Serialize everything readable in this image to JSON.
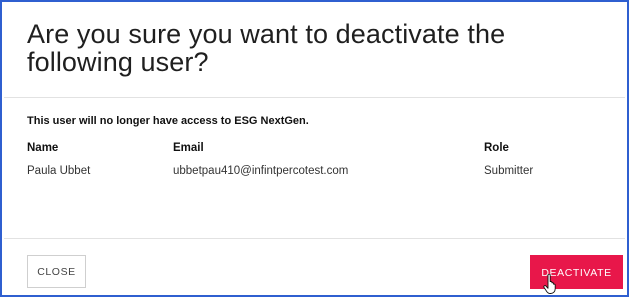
{
  "dialog": {
    "title": "Are you sure you want to deactivate the following user?",
    "warning": "This user will no longer have access to ESG NextGen.",
    "columns": {
      "name": "Name",
      "email": "Email",
      "role": "Role"
    },
    "user": {
      "name": "Paula Ubbet",
      "email": "ubbetpau410@infintpercotest.com",
      "role": "Submitter"
    },
    "buttons": {
      "close": "CLOSE",
      "deactivate": "DEACTIVATE"
    }
  },
  "colors": {
    "frame_border": "#2f5fd0",
    "deactivate_button": "#e8174a",
    "close_border": "#cfcfcf"
  },
  "icons": {
    "cursor": "hand-pointer-icon"
  }
}
